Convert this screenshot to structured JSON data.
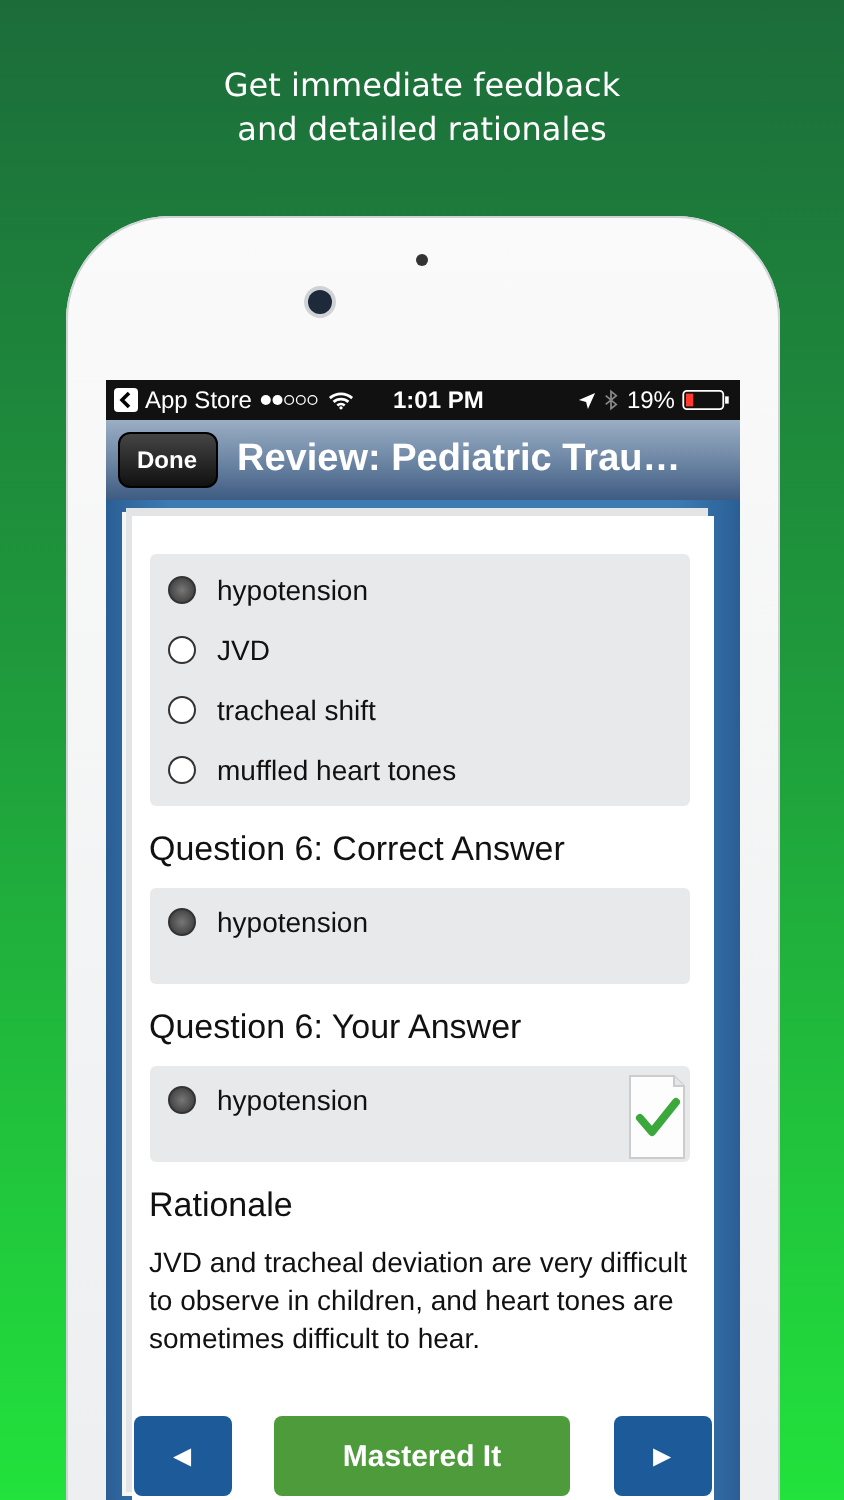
{
  "headline": [
    "Get immediate feedback",
    "and detailed rationales"
  ],
  "status_bar": {
    "back_label": "App Store",
    "time": "1:01 PM",
    "battery": "19%"
  },
  "nav": {
    "done_button": "Done",
    "title": "Review: Pediatric Trau…"
  },
  "options": [
    {
      "label": "hypotension",
      "selected": true
    },
    {
      "label": "JVD",
      "selected": false
    },
    {
      "label": "tracheal shift",
      "selected": false
    },
    {
      "label": "muffled heart tones",
      "selected": false
    }
  ],
  "answer_sections": [
    {
      "heading": "Question 6: Correct Answer",
      "answers": [
        {
          "label": "hypotension",
          "selected": true
        }
      ],
      "marked_correct": false
    },
    {
      "heading": "Question 6: Your Answer",
      "answers": [
        {
          "label": "hypotension",
          "selected": true
        }
      ],
      "marked_correct": true
    }
  ],
  "rationale": {
    "heading": "Rationale",
    "text": "JVD and tracheal deviation are very difficult to observe in children, and heart tones are sometimes difficult to hear."
  },
  "buttons": [
    {
      "kind": "prev",
      "label": "◄"
    },
    {
      "kind": "mastered",
      "label": "Mastered It"
    },
    {
      "kind": "next",
      "label": "►"
    }
  ]
}
